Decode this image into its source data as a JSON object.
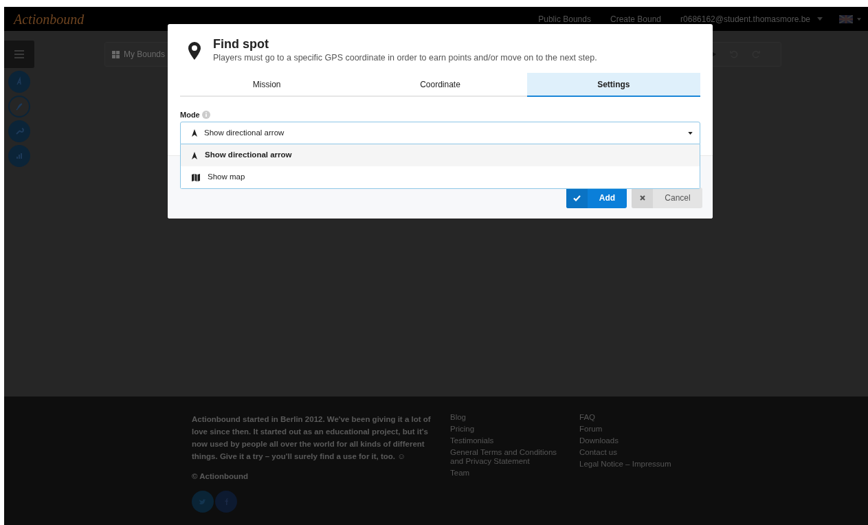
{
  "header": {
    "logo": "Actionbound",
    "nav": [
      "Public Bounds",
      "Create Bound"
    ],
    "user": "r0686162@student.thomasmore.be"
  },
  "toolbar": {
    "my_bounds": "My Bounds"
  },
  "modal": {
    "title": "Find spot",
    "description": "Players must go to a specific GPS coordinate in order to earn points and/or move on to the next step.",
    "tabs": [
      {
        "label": "Mission",
        "selected": false
      },
      {
        "label": "Coordinate",
        "selected": false
      },
      {
        "label": "Settings",
        "selected": true
      }
    ],
    "field_label": "Mode",
    "select_value": "Show directional arrow",
    "options": [
      {
        "label": "Show directional arrow",
        "kind": "arrow",
        "selected": true
      },
      {
        "label": "Show map",
        "kind": "map",
        "selected": false
      }
    ],
    "buttons": [
      {
        "label": "Add",
        "kind": "primary"
      },
      {
        "label": "Cancel",
        "kind": "secondary"
      }
    ]
  },
  "footer": {
    "about": "Actionbound started in Berlin 2012. We've been giving it a lot of love since then. It started out as an educational project, but it's now used by people all over the world for all kinds of different things. Give it a try – you'll surely find a use for it, too. ☺",
    "copyright": "© Actionbound",
    "links_1": [
      "Blog",
      "Pricing",
      "Testimonials",
      "General Terms and Conditions and Privacy Statement",
      "Team"
    ],
    "links_2": [
      "FAQ",
      "Forum",
      "Downloads",
      "Contact us",
      "Legal Notice – Impressum"
    ]
  }
}
